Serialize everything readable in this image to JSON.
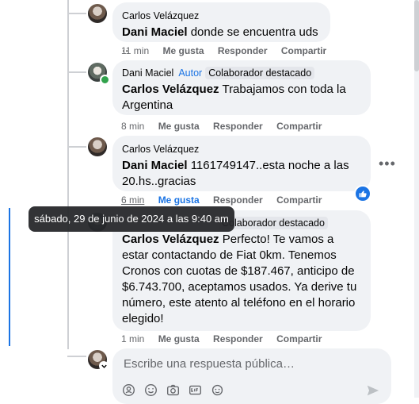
{
  "comments": [
    {
      "author": "Carlos Velázquez",
      "mention": "Dani Maciel",
      "text": " donde se encuentra uds ..",
      "time": "11 min",
      "like": "Me gusta",
      "reply": "Responder",
      "share": "Compartir"
    },
    {
      "author": "Dani Maciel",
      "author_badge": "Autor",
      "collab_badge": "Colaborador destacado",
      "mention": "Carlos Velázquez",
      "text": " Trabajamos con toda la Argentina",
      "time": "8 min",
      "like": "Me gusta",
      "reply": "Responder",
      "share": "Compartir"
    },
    {
      "author": "Carlos Velázquez",
      "mention": "Dani Maciel",
      "text": " 1161749147..esta noche a las 20.hs..gracias",
      "time": "6 min",
      "like": "Me gusta",
      "reply": "Responder",
      "share": "Compartir"
    },
    {
      "collab_badge": "Colaborador destacado",
      "mention": "Carlos Velázquez",
      "text": " Perfecto! Te vamos a estar contactando de Fiat 0km. Tenemos Cronos con cuotas de $187.467, anticipo de $6.743.700, aceptamos usados. Ya derive tu número, este atento al teléfono en el horario elegido!",
      "time": "1 min",
      "like": "Me gusta",
      "reply": "Responder",
      "share": "Compartir"
    }
  ],
  "tooltip": "sábado, 29 de junio de 2024 a las 9:40 am",
  "reply_box": {
    "placeholder": "Escribe una respuesta pública…"
  },
  "colors": {
    "accent": "#1b74e4",
    "bubble": "#f0f2f5",
    "muted": "#65676b"
  }
}
